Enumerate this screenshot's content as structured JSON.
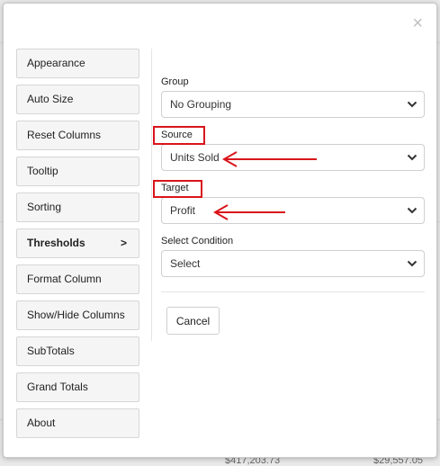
{
  "dialog": {
    "close_glyph": "×",
    "menu": [
      {
        "label": "Appearance"
      },
      {
        "label": "Auto Size"
      },
      {
        "label": "Reset Columns"
      },
      {
        "label": "Tooltip"
      },
      {
        "label": "Sorting"
      },
      {
        "label": "Thresholds",
        "active": true,
        "indicator": ">"
      },
      {
        "label": "Format Column"
      },
      {
        "label": "Show/Hide Columns"
      },
      {
        "label": "SubTotals"
      },
      {
        "label": "Grand Totals"
      },
      {
        "label": "About"
      }
    ],
    "fields": {
      "group": {
        "label": "Group",
        "value": "No Grouping"
      },
      "source": {
        "label": "Source",
        "value": "Units Sold"
      },
      "target": {
        "label": "Target",
        "value": "Profit"
      },
      "condition": {
        "label": "Select Condition",
        "value": "Select"
      }
    },
    "cancel_label": "Cancel",
    "annotation_color": "#d9151b"
  },
  "background": {
    "values": [
      "$417,203.73",
      "$29,557.05"
    ]
  }
}
